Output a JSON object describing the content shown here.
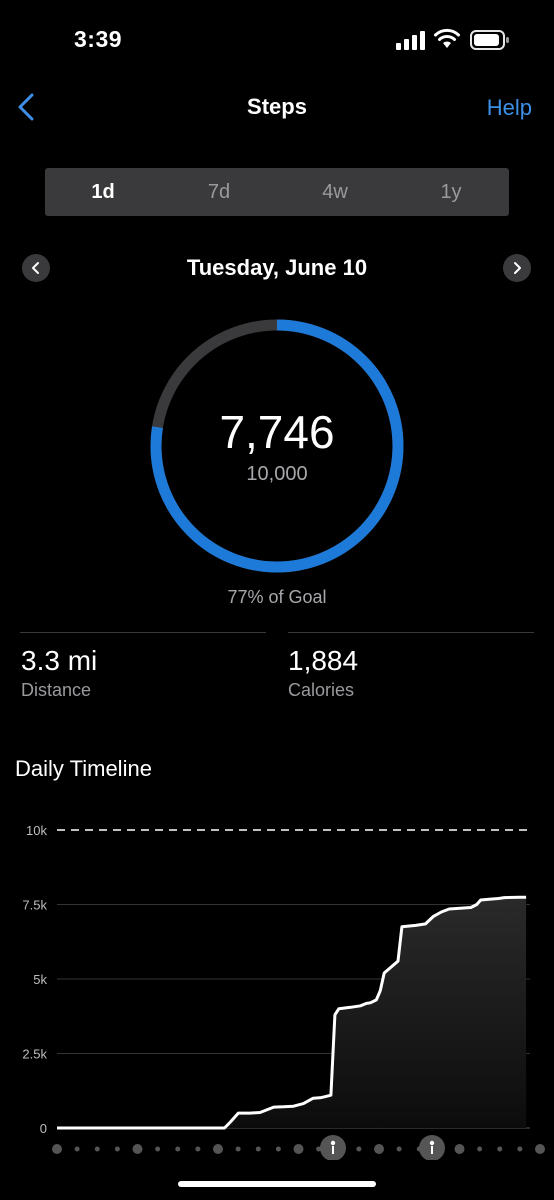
{
  "status_bar": {
    "time": "3:39"
  },
  "header": {
    "title": "Steps",
    "help_label": "Help"
  },
  "periods": [
    {
      "label": "1d",
      "active": true
    },
    {
      "label": "7d",
      "active": false
    },
    {
      "label": "4w",
      "active": false
    },
    {
      "label": "1y",
      "active": false
    }
  ],
  "date_label": "Tuesday, June 10",
  "summary": {
    "steps": "7,746",
    "goal": "10,000",
    "percent_label": "77% of Goal",
    "progress_fraction": 0.7746
  },
  "stats": {
    "distance_value": "3.3 mi",
    "distance_label": "Distance",
    "calories_value": "1,884",
    "calories_label": "Calories"
  },
  "timeline": {
    "title": "Daily Timeline"
  },
  "colors": {
    "accent": "#1e7ad8",
    "ring_track": "#3a3a3c",
    "link": "#3d8fe8"
  },
  "chart_data": {
    "type": "area",
    "title": "Daily Timeline",
    "ytick_labels": [
      "0",
      "2.5k",
      "5k",
      "7.5k",
      "10k"
    ],
    "yticks": [
      0,
      2500,
      5000,
      7500,
      10000
    ],
    "ylim": [
      0,
      10000
    ],
    "xlim": [
      0,
      24
    ],
    "goal_line": 10000,
    "grid": true,
    "series": [
      {
        "x": [
          0,
          8.5,
          8.8,
          9.2,
          9.8,
          10.3,
          11.0,
          11.5,
          12.0,
          12.5,
          13.0,
          13.4,
          13.6,
          13.9,
          14.1,
          14.3,
          14.9,
          15.4,
          15.7,
          15.9,
          16.2,
          16.4,
          16.6,
          17.3,
          17.5,
          18.2,
          18.7,
          19.1,
          19.5,
          19.9,
          21.0,
          21.3,
          21.5,
          22.0,
          22.4,
          22.7,
          23.5,
          23.8
        ],
        "values": [
          0,
          0,
          200,
          500,
          500,
          520,
          700,
          710,
          730,
          820,
          1000,
          1020,
          1050,
          1100,
          3800,
          4000,
          4050,
          4100,
          4180,
          4200,
          4300,
          4600,
          5200,
          5600,
          6750,
          6800,
          6850,
          7100,
          7250,
          7350,
          7400,
          7500,
          7650,
          7680,
          7700,
          7730,
          7746,
          7746
        ]
      }
    ]
  }
}
